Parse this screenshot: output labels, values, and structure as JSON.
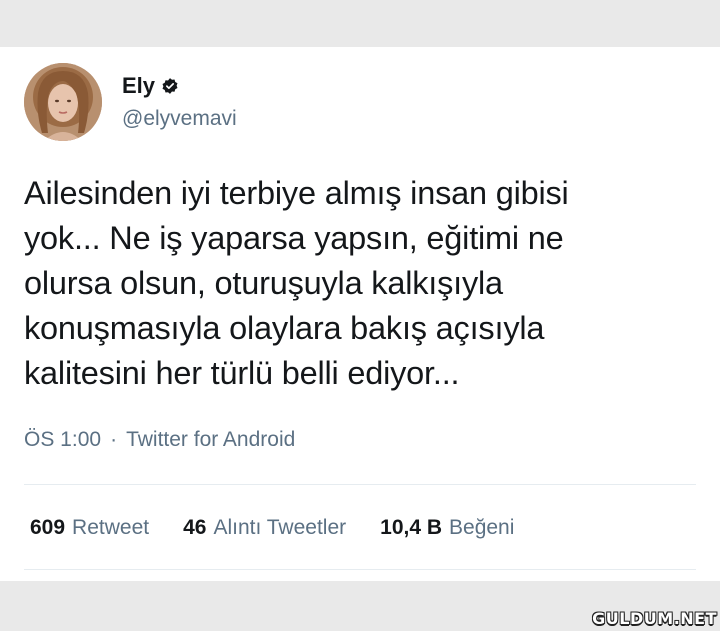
{
  "tweet": {
    "author": {
      "display_name": "Ely",
      "handle": "@elyvemavi",
      "verified_icon": "verified-badge-icon",
      "avatar": "profile-photo"
    },
    "text": "Ailesinden iyi terbiye almış insan gibisi\nyok... Ne iş yaparsa yapsın, eğitimi ne\nolursa olsun, oturuşuyla kalkışıyla\nkonuşmasıyla olaylara bakış açısıyla\nkalitesini her türlü belli ediyor...",
    "time": "ÖS 1:00",
    "separator": "·",
    "source": "Twitter for Android",
    "stats": {
      "retweets": {
        "count": "609",
        "label": "Retweet"
      },
      "quotes": {
        "count": "46",
        "label": "Alıntı Tweetler"
      },
      "likes": {
        "count": "10,4 B",
        "label": "Beğeni"
      }
    }
  },
  "watermark": "GULDUM.NET"
}
